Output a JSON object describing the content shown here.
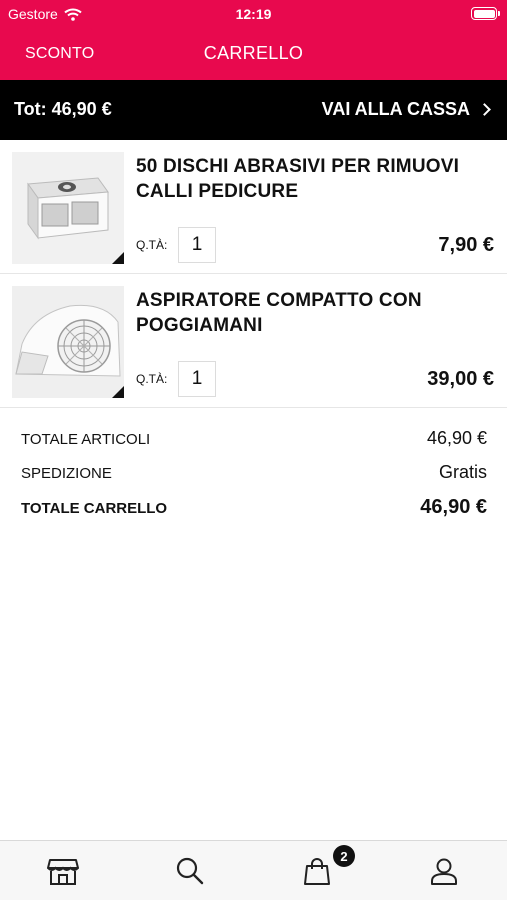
{
  "status_bar": {
    "carrier": "Gestore",
    "time": "12:19"
  },
  "nav": {
    "discount_label": "SCONTO",
    "title": "CARRELLO"
  },
  "total_bar": {
    "total_text": "Tot: 46,90 €",
    "checkout_label": "VAI ALLA CASSA"
  },
  "cart": {
    "items": [
      {
        "name": "50 DISCHI ABRASIVI PER RIMUOVI CALLI PEDICURE",
        "qty_label": "Q.TÀ:",
        "qty": "1",
        "price": "7,90 €"
      },
      {
        "name": "ASPIRATORE COMPATTO CON POGGIAMANI",
        "qty_label": "Q.TÀ:",
        "qty": "1",
        "price": "39,00 €"
      }
    ]
  },
  "summary": {
    "items_total_label": "TOTALE ARTICOLI",
    "items_total_value": "46,90 €",
    "shipping_label": "SPEDIZIONE",
    "shipping_value": "Gratis",
    "cart_total_label": "TOTALE CARRELLO",
    "cart_total_value": "46,90 €"
  },
  "tab_bar": {
    "tabs": [
      {
        "icon": "store-icon"
      },
      {
        "icon": "search-icon"
      },
      {
        "icon": "shopping-bag-icon",
        "badge": "2"
      },
      {
        "icon": "user-icon"
      }
    ]
  },
  "colors": {
    "brand": "#e8094e",
    "bar": "#000000",
    "text": "#111111"
  }
}
